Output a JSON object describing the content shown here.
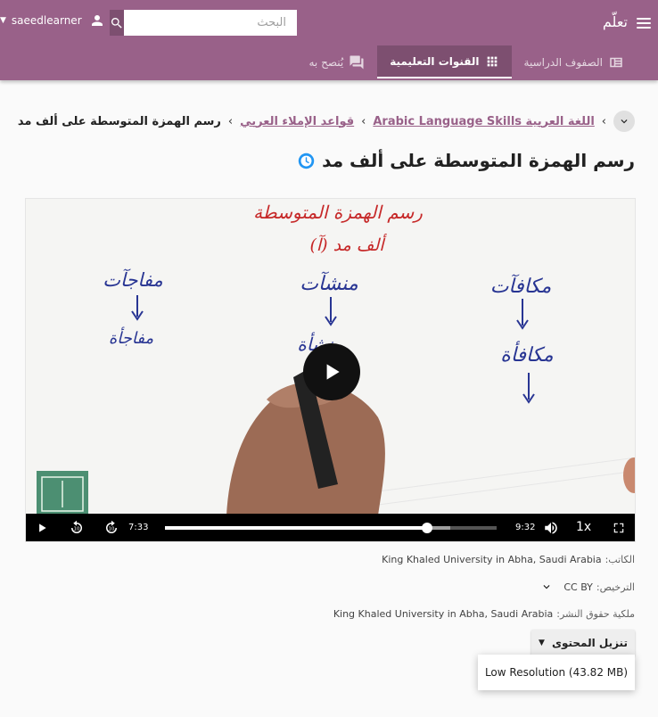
{
  "header": {
    "app_title": "تعلّم",
    "username": "saeedlearner",
    "search": {
      "placeholder": "البحث",
      "value": ""
    },
    "tabs": [
      {
        "label": "الصفوف الدراسية",
        "icon": "classes-icon",
        "active": false
      },
      {
        "label": "القنوات التعليمية",
        "icon": "channels-grid-icon",
        "active": true
      },
      {
        "label": "يُنصح به",
        "icon": "recommended-chat-icon",
        "active": false
      }
    ]
  },
  "breadcrumb": {
    "items": [
      "اللغة العربية Arabic Language Skills",
      "قواعد الإملاء العربي"
    ],
    "current": "رسم الهمزة المتوسطة على ألف مد"
  },
  "content": {
    "title": "رسم الهمزة المتوسطة على ألف مد",
    "status_icon": "in-progress-clock-icon",
    "status_color": "#2196f3"
  },
  "player": {
    "current_time": "7:33",
    "duration": "9:32",
    "played_fraction": 0.79,
    "buffered_fraction": 0.86,
    "speed": "1x",
    "whiteboard": {
      "heading_line1": "رسم الهمزة المتوسطة",
      "heading_line2": "ألف مد (آ)",
      "word1_top": "مكافآت",
      "word1_bottom": "مكافأة",
      "word2_top": "منشآت",
      "word2_bottom": "منشأة",
      "word3_top": "مفاجآت",
      "word3_bottom": "مفاجأة"
    }
  },
  "metadata": {
    "author_label": "الكاتب:",
    "author_value": "King Khaled University in Abha, Saudi Arabia",
    "license_label": "الترخيص:",
    "license_value": "CC BY",
    "copyright_label": "ملكية حقوق النشر:",
    "copyright_value": "King Khaled University in Abha, Saudi Arabia"
  },
  "download": {
    "button_label": "تنزيل المحتوى",
    "options": [
      "Low Resolution (43.82 MB)"
    ]
  },
  "colors": {
    "brand": "#996189",
    "brand_dark": "#7d4f70",
    "ink_red": "#c62828",
    "ink_blue": "#283593"
  }
}
